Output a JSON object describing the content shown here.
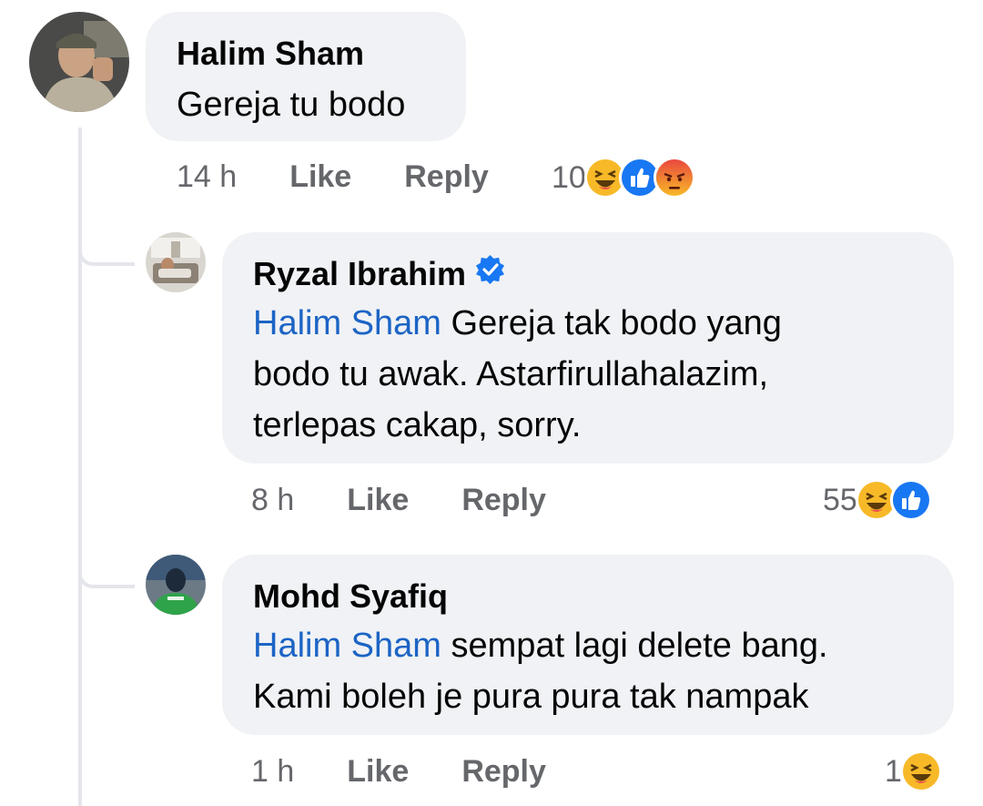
{
  "comments": [
    {
      "author": "Halim Sham",
      "text": "Gereja tu bodo",
      "time": "14 h",
      "like_label": "Like",
      "reply_label": "Reply",
      "reaction_count": "10",
      "reactions": [
        "haha-icon",
        "like-icon",
        "angry-icon"
      ]
    },
    {
      "author": "Ryzal Ibrahim",
      "verified": true,
      "mention": "Halim Sham",
      "text_line1": "Gereja tak bodo yang",
      "text_line2": "bodo tu awak. Astarfirullahalazim,",
      "text_line3": "terlepas cakap, sorry.",
      "time": "8 h",
      "like_label": "Like",
      "reply_label": "Reply",
      "reaction_count": "55",
      "reactions": [
        "haha-icon",
        "like-icon"
      ]
    },
    {
      "author": "Mohd Syafiq",
      "mention": "Halim Sham",
      "text_line1": "sempat lagi delete bang.",
      "text_line2": "Kami boleh je pura pura tak nampak",
      "time": "1 h",
      "like_label": "Like",
      "reply_label": "Reply",
      "reaction_count": "1",
      "reactions": [
        "haha-icon"
      ]
    }
  ],
  "colors": {
    "bubble": "#f0f2f5",
    "mention": "#1c64c5",
    "meta": "#65676b",
    "like": "#1877f2",
    "haha": "#f7b928",
    "angry": "#e9710f"
  }
}
